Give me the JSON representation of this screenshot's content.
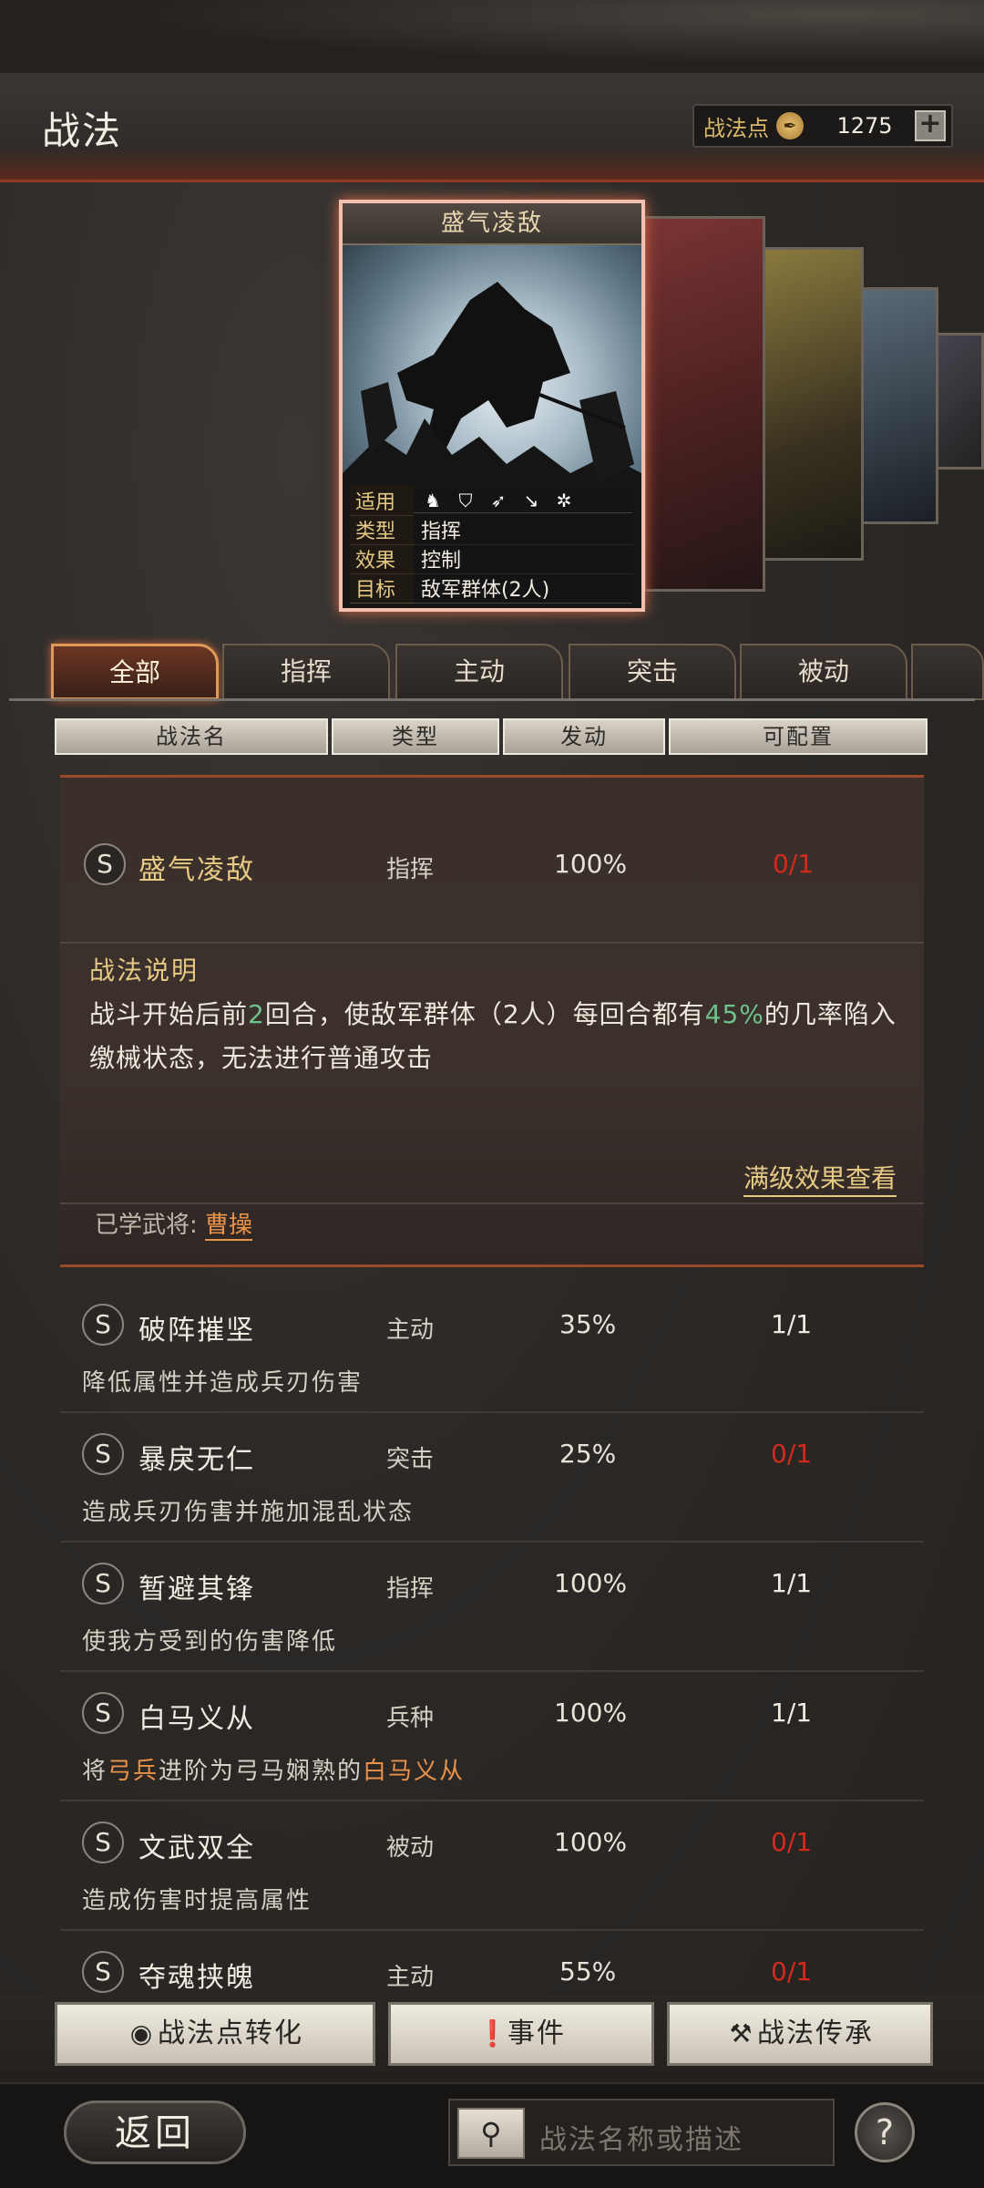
{
  "header": {
    "title": "战法",
    "points_label": "战法点",
    "points_value": "1275",
    "coin_icon": "feather-coin-icon",
    "add_label": "+"
  },
  "card": {
    "title": "盛气凌敌",
    "rows": [
      {
        "key": "适用",
        "value": ""
      },
      {
        "key": "类型",
        "value": "指挥"
      },
      {
        "key": "效果",
        "value": "控制"
      },
      {
        "key": "目标",
        "value": "敌军群体(2人)"
      }
    ]
  },
  "tabs": [
    "全部",
    "指挥",
    "主动",
    "突击",
    "被动"
  ],
  "columns": [
    "战法名",
    "类型",
    "发动",
    "可配置"
  ],
  "expanded": {
    "grade": "S",
    "name": "盛气凌敌",
    "type": "指挥",
    "rate": "100%",
    "config": "0/1",
    "desc_title": "战法说明",
    "desc_p1": "战斗开始后前",
    "desc_n1": "2",
    "desc_p2": "回合，使敌军群体（2人）每回合都有",
    "desc_n2": "45%",
    "desc_p3": "的几率陷入缴械状态，无法进行普通攻击",
    "max_link": "满级效果查看",
    "learned_label": "已学武将:",
    "learned_general": "曹操"
  },
  "list": [
    {
      "grade": "S",
      "name": "破阵摧坚",
      "type": "主动",
      "rate": "35%",
      "config": "1/1",
      "desc": "降低属性并造成兵刃伤害"
    },
    {
      "grade": "S",
      "name": "暴戾无仁",
      "type": "突击",
      "rate": "25%",
      "config": "0/1",
      "desc": "造成兵刃伤害并施加混乱状态"
    },
    {
      "grade": "S",
      "name": "暂避其锋",
      "type": "指挥",
      "rate": "100%",
      "config": "1/1",
      "desc": "使我方受到的伤害降低"
    },
    {
      "grade": "S",
      "name": "白马义从",
      "type": "兵种",
      "rate": "100%",
      "config": "1/1",
      "desc_a": "将",
      "desc_b": "弓兵",
      "desc_c": "进阶为弓马娴熟的",
      "desc_d": "白马义从"
    },
    {
      "grade": "S",
      "name": "文武双全",
      "type": "被动",
      "rate": "100%",
      "config": "0/1",
      "desc": "造成伤害时提高属性"
    },
    {
      "grade": "S",
      "name": "夺魂挟魄",
      "type": "主动",
      "rate": "55%",
      "config": "0/1"
    }
  ],
  "buttons": {
    "convert": "战法点转化",
    "event": "事件",
    "inherit": "战法传承"
  },
  "footer": {
    "back": "返回",
    "search_placeholder": "战法名称或描述",
    "help": "?"
  }
}
